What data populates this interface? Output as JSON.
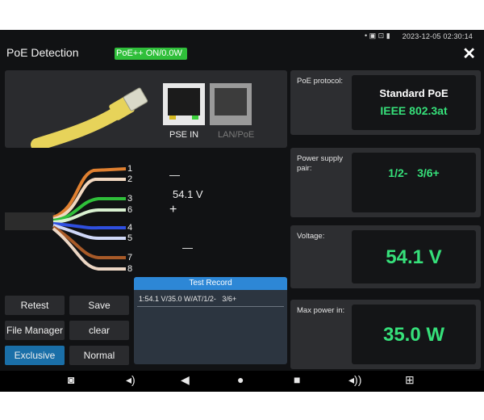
{
  "status_bar": {
    "icons_text": "•  ▣ ⊡ ▮",
    "datetime": "2023-12-05 02:30:14"
  },
  "title_bar": {
    "title": "PoE Detection",
    "poe_status": "PoE++ ON/0.0W",
    "close_icon": "close-icon"
  },
  "ports": {
    "pse_in": "PSE IN",
    "lan_poe": "LAN/PoE"
  },
  "wiring": {
    "pin_numbers": [
      "1",
      "2",
      "3",
      "6",
      "4",
      "5",
      "7",
      "8"
    ],
    "neg_sign_top": "—",
    "voltage": "54.1 V",
    "pos_sign": "+",
    "neg_sign_bottom": "—",
    "pair_colors": {
      "orange": "#e08030",
      "green": "#2fbf3a",
      "blue": "#2f4fe0",
      "brown": "#a85a28"
    }
  },
  "cards": {
    "protocol": {
      "label": "PoE protocol:",
      "standard": "Standard PoE",
      "ieee": "IEEE 802.3at"
    },
    "supply_pair": {
      "label": "Power supply pair:",
      "value": "1/2-   3/6+"
    },
    "voltage": {
      "label": "Voltage:",
      "value": "54.1 V"
    },
    "max_power": {
      "label": "Max power in:",
      "value": "35.0 W"
    }
  },
  "buttons": {
    "retest": "Retest",
    "save": "Save",
    "file_manager": "File Manager",
    "clear": "clear",
    "exclusive": "Exclusive",
    "normal": "Normal"
  },
  "test_record": {
    "header": "Test Record",
    "rows": [
      "1:54.1 V/35.0 W/AT/1/2-   3/6+"
    ]
  },
  "nav_bar": {
    "icons": [
      "camera-icon",
      "volume-down-icon",
      "back-icon",
      "home-icon",
      "recents-icon",
      "volume-up-icon",
      "apps-icon"
    ]
  },
  "colors": {
    "accent_green": "#36e07a",
    "status_green": "#2fbf3a",
    "active_blue": "#1a6fa8",
    "record_header": "#2d87d6"
  }
}
